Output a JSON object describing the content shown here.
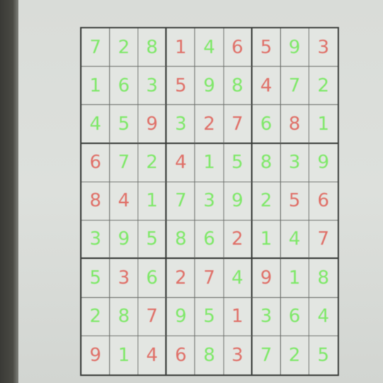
{
  "puzzle": {
    "rows": [
      [
        "7",
        "2",
        "8",
        "1",
        "4",
        "6",
        "5",
        "9",
        "3"
      ],
      [
        "1",
        "6",
        "3",
        "5",
        "9",
        "8",
        "4",
        "7",
        "2"
      ],
      [
        "4",
        "5",
        "9",
        "3",
        "2",
        "7",
        "6",
        "8",
        "1"
      ],
      [
        "6",
        "7",
        "2",
        "4",
        "1",
        "5",
        "8",
        "3",
        "9"
      ],
      [
        "8",
        "4",
        "1",
        "7",
        "3",
        "9",
        "2",
        "5",
        "6"
      ],
      [
        "3",
        "9",
        "5",
        "8",
        "6",
        "2",
        "1",
        "4",
        "7"
      ],
      [
        "5",
        "3",
        "6",
        "2",
        "7",
        "4",
        "9",
        "1",
        "8"
      ],
      [
        "2",
        "8",
        "7",
        "9",
        "5",
        "1",
        "3",
        "6",
        "4"
      ],
      [
        "9",
        "1",
        "4",
        "6",
        "8",
        "3",
        "7",
        "2",
        "5"
      ]
    ],
    "colors": [
      [
        "green",
        "green",
        "green",
        "red",
        "green",
        "red",
        "red",
        "green",
        "red"
      ],
      [
        "green",
        "green",
        "green",
        "red",
        "green",
        "green",
        "red",
        "green",
        "green"
      ],
      [
        "green",
        "green",
        "red",
        "green",
        "red",
        "red",
        "green",
        "red",
        "green"
      ],
      [
        "red",
        "green",
        "green",
        "red",
        "green",
        "green",
        "green",
        "green",
        "green"
      ],
      [
        "red",
        "red",
        "green",
        "green",
        "green",
        "green",
        "green",
        "red",
        "red"
      ],
      [
        "green",
        "green",
        "green",
        "green",
        "green",
        "red",
        "green",
        "green",
        "red"
      ],
      [
        "green",
        "red",
        "green",
        "red",
        "red",
        "green",
        "red",
        "green",
        "green"
      ],
      [
        "green",
        "green",
        "red",
        "green",
        "green",
        "red",
        "green",
        "green",
        "green"
      ],
      [
        "red",
        "green",
        "red",
        "red",
        "green",
        "red",
        "green",
        "green",
        "green"
      ]
    ],
    "palette": {
      "green": "#7ee868",
      "red": "#e07068"
    }
  }
}
